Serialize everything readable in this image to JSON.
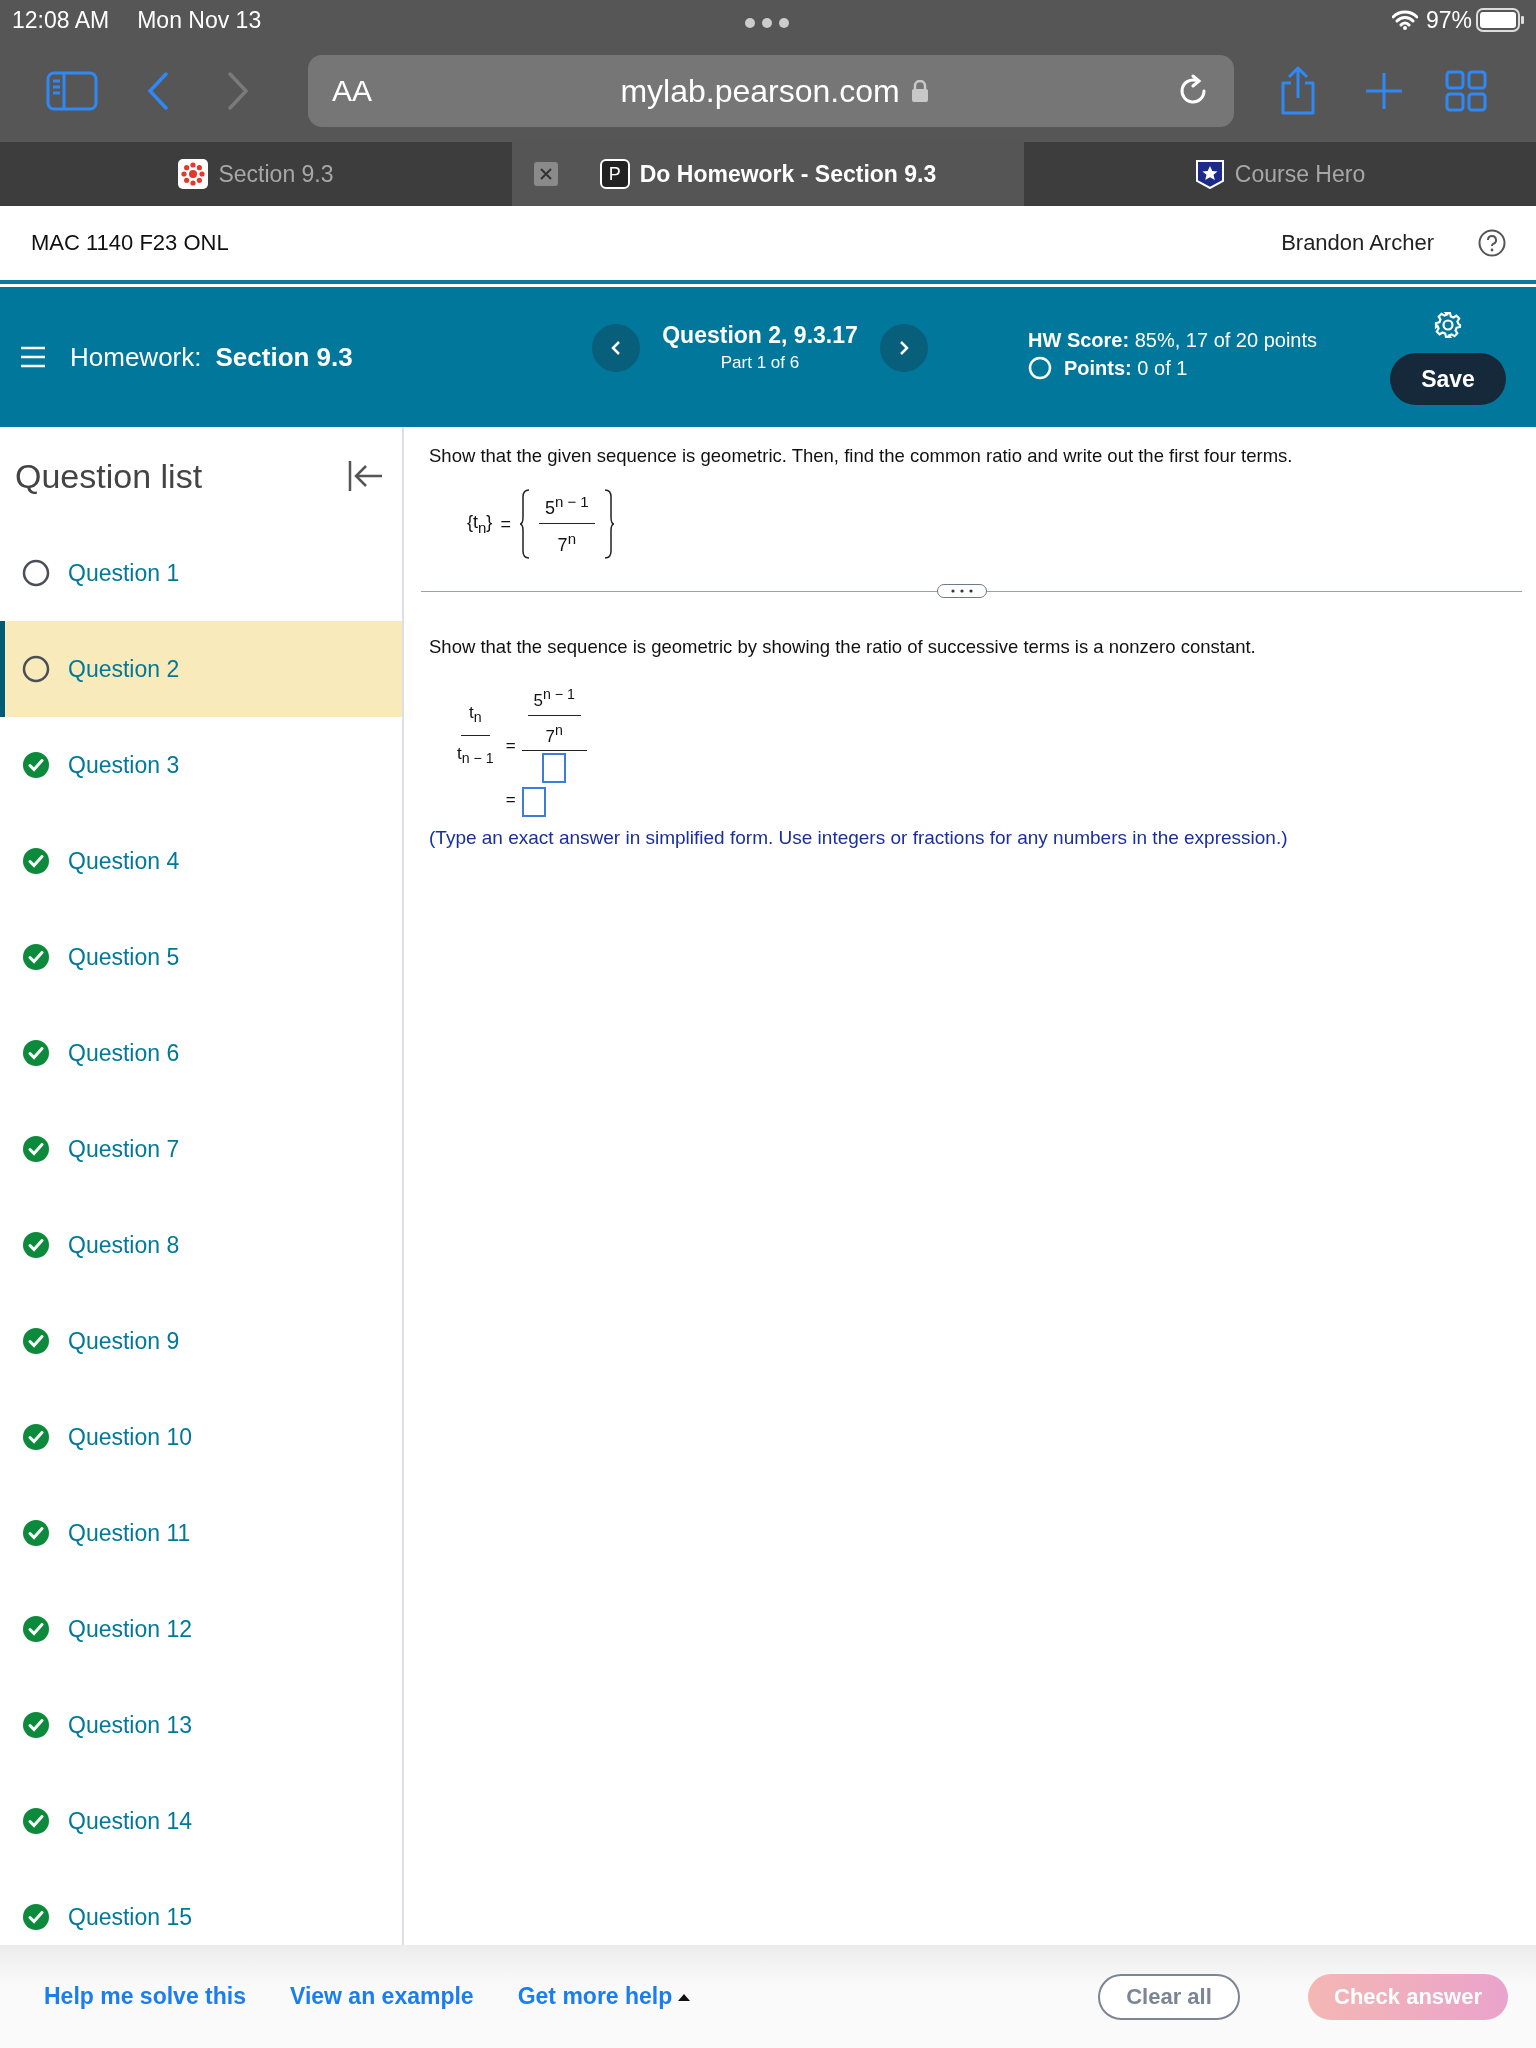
{
  "status_bar": {
    "time": "12:08 AM",
    "date": "Mon Nov 13",
    "battery": "97%"
  },
  "browser": {
    "text_size": "AA",
    "url": "mylab.pearson.com",
    "tabs": [
      {
        "title": "Section 9.3",
        "selected": false,
        "kind": "canvas"
      },
      {
        "title": "Do Homework - Section 9.3",
        "selected": true,
        "kind": "letter",
        "icon_text": "P"
      },
      {
        "title": "Course Hero",
        "selected": false,
        "kind": "star"
      }
    ]
  },
  "course": {
    "name": "MAC 1140 F23 ONL",
    "user": "Brandon Archer"
  },
  "homework_bar": {
    "label": "Homework:",
    "section": "Section 9.3",
    "question": "Question 2, 9.3.17",
    "part": "Part 1 of 6",
    "hw_score_label": "HW Score:",
    "hw_score": "85%, 17 of 20 points",
    "points_label": "Points:",
    "points": "0 of 1",
    "save": "Save"
  },
  "sidebar": {
    "title": "Question list",
    "items": [
      {
        "label": "Question 1",
        "done": false,
        "selected": false
      },
      {
        "label": "Question 2",
        "done": false,
        "selected": true
      },
      {
        "label": "Question 3",
        "done": true,
        "selected": false
      },
      {
        "label": "Question 4",
        "done": true,
        "selected": false
      },
      {
        "label": "Question 5",
        "done": true,
        "selected": false
      },
      {
        "label": "Question 6",
        "done": true,
        "selected": false
      },
      {
        "label": "Question 7",
        "done": true,
        "selected": false
      },
      {
        "label": "Question 8",
        "done": true,
        "selected": false
      },
      {
        "label": "Question 9",
        "done": true,
        "selected": false
      },
      {
        "label": "Question 10",
        "done": true,
        "selected": false
      },
      {
        "label": "Question 11",
        "done": true,
        "selected": false
      },
      {
        "label": "Question 12",
        "done": true,
        "selected": false
      },
      {
        "label": "Question 13",
        "done": true,
        "selected": false
      },
      {
        "label": "Question 14",
        "done": true,
        "selected": false
      },
      {
        "label": "Question 15",
        "done": true,
        "selected": false
      }
    ]
  },
  "question": {
    "prompt": "Show that the given sequence is geometric. Then, find the common ratio and write out the first four terms.",
    "sequence_lhs": "{t$_{n}$}",
    "equals": "=",
    "numerator": "5$^{n − 1}$",
    "denominator": "7$^{n}$",
    "step_prompt": "Show that the sequence is geometric by showing the ratio of successive terms is a nonzero constant.",
    "ratio_top": "t$_{n}$",
    "ratio_bottom": "t$_{n − 1}$",
    "ratio_equals": "=",
    "inner_numerator": "5$^{n − 1}$",
    "inner_denominator": "7$^{n}$",
    "result_equals": "=",
    "instruction": "(Type an exact answer in simplified form. Use integers or fractions for any numbers in the expression.)"
  },
  "footer": {
    "links": [
      "Help me solve this",
      "View an example",
      "Get more help"
    ],
    "clear": "Clear all",
    "check": "Check answer",
    "check_disabled": true
  }
}
